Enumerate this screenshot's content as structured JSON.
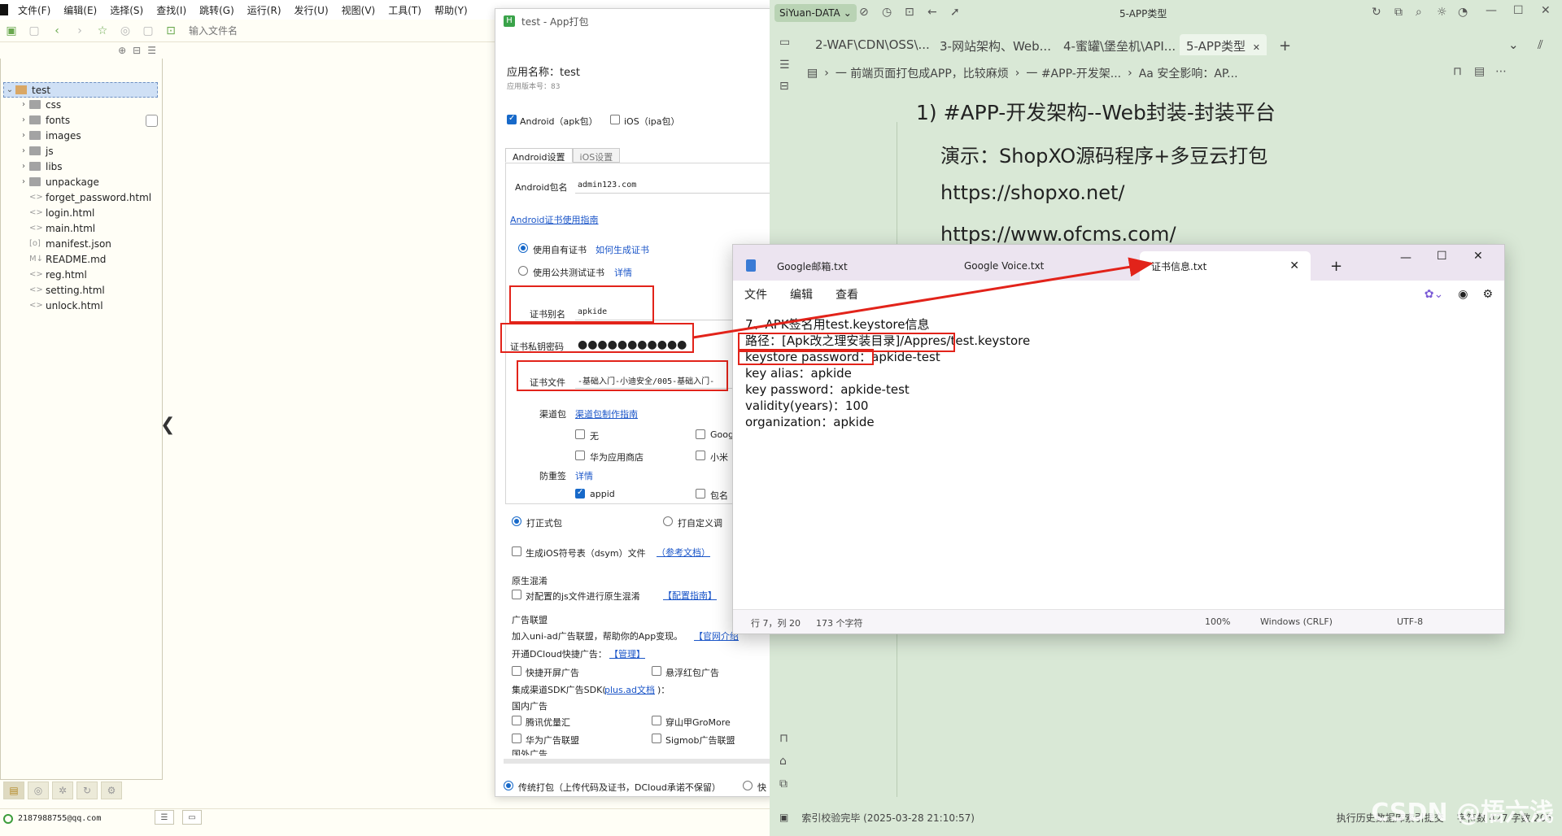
{
  "ide": {
    "menu": [
      "文件(F)",
      "编辑(E)",
      "选择(S)",
      "查找(I)",
      "跳转(G)",
      "运行(R)",
      "发行(U)",
      "视图(V)",
      "工具(T)",
      "帮助(Y)"
    ],
    "file_input_placeholder": "输入文件名",
    "tree": {
      "root": "test",
      "folders": [
        "css",
        "fonts",
        "images",
        "js",
        "libs",
        "unpackage"
      ],
      "files": [
        {
          "name": "forget_password.html",
          "icon": "<>"
        },
        {
          "name": "login.html",
          "icon": "<>"
        },
        {
          "name": "main.html",
          "icon": "<>"
        },
        {
          "name": "manifest.json",
          "icon": "[o]"
        },
        {
          "name": "README.md",
          "icon": "M↓"
        },
        {
          "name": "reg.html",
          "icon": "<>"
        },
        {
          "name": "setting.html",
          "icon": "<>"
        },
        {
          "name": "unlock.html",
          "icon": "<>"
        }
      ]
    },
    "status_user": "2187988755@qq.com"
  },
  "pkg": {
    "title": "test - App打包",
    "app_name": "应用名称：test",
    "app_version": "应用版本号：83",
    "platform_android": "Android（apk包）",
    "platform_ios": "iOS（ipa包）",
    "tab_android": "Android设置",
    "tab_ios": "iOS设置",
    "package_label": "Android包名",
    "package_value": "admin123.com",
    "cert_guide": "Android证书使用指南",
    "own_cert": "使用自有证书",
    "how_cert": "如何生成证书",
    "public_cert": "使用公共测试证书",
    "detail": "详情",
    "alias_label": "证书别名",
    "alias_value": "apkide",
    "password_label": "证书私钥密码",
    "password_value": "●●●●●●●●●●●",
    "file_label": "证书文件",
    "file_value": "-基础入门-小迪安全/005-基础入门-",
    "channel_label": "渠道包",
    "channel_guide": "渠道包制作指南",
    "ch_none": "无",
    "ch_google": "Goog",
    "ch_huawei": "华为应用商店",
    "ch_xiaomi": "小米",
    "anti_sign": "防重签",
    "anti_detail": "详情",
    "appid": "appid",
    "pkgname": "包名",
    "formal_pkg": "打正式包",
    "custom_pkg": "打自定义调",
    "dsym": "生成iOS符号表（dsym）文件",
    "dsym_doc": "（参考文档）",
    "native_mix": "原生混淆",
    "native_mix_cb": "对配置的js文件进行原生混淆",
    "native_mix_link": "【配置指南】",
    "ad_title": "广告联盟",
    "ad_join": "加入uni-ad广告联盟，帮助你的App变现。",
    "ad_join_link": "【官网介绍",
    "ad_quick": "开通DCloud快捷广告：",
    "ad_manage": "【管理】",
    "ad_splash": "快捷开屏广告",
    "ad_redpack": "悬浮红包广告",
    "ad_sdk": "集成渠道SDK广告SDK(",
    "ad_sdk_link": "plus.ad文档",
    "ad_sdk_end": ")：",
    "ad_domestic": "国内广告",
    "ad_tencent": "腾讯优量汇",
    "ad_gromore": "穿山甲GroMore",
    "ad_huawei": "华为广告联盟",
    "ad_sigmob": "Sigmob广告联盟",
    "ad_foreign": "国外广告",
    "traditional": "传统打包（上传代码及证书，DCloud承诺不保留）",
    "quick": "快"
  },
  "siyuan": {
    "workspace": "SiYuan-DATA",
    "window_title": "5-APP类型",
    "tabs": [
      "2-WAF\\CDN\\OSS\\...",
      "3-网站架构、Web...",
      "4-蜜罐\\堡垒机\\API...",
      "5-APP类型"
    ],
    "breadcrumb": [
      "一 前端页面打包成APP，比较麻烦",
      "一 #APP-开发架...",
      "Aa 安全影响：AP..."
    ],
    "heading": "1) #APP-开发架构--Web封装-封装平台",
    "lines": [
      "演示：ShopXO源码程序+多豆云打包",
      "https://shopxo.net/",
      "https://www.ofcms.com/"
    ],
    "status_left": "索引校验完毕 (2025-03-28 21:10:57)",
    "status_right": "执行历史数据库索引提交",
    "status_count": "字符数 427 字数 205"
  },
  "notepad": {
    "tabs": [
      "Google邮箱.txt",
      "Google Voice.txt",
      "证书信息.txt"
    ],
    "menu": [
      "文件",
      "编辑",
      "查看"
    ],
    "lines": [
      "7、APK签名用test.keystore信息",
      "路径：[Apk改之理安装目录]/Appres/test.keystore",
      "keystore password：apkide-test",
      "key alias：apkide",
      "key password：apkide-test",
      "validity(years)：100",
      "organization：apkide"
    ],
    "status_pos": "行 7，列 20",
    "status_chars": "173 个字符",
    "status_zoom": "100%",
    "status_eol": "Windows (CRLF)",
    "status_enc": "UTF-8"
  },
  "watermark": "CSDN @梧六浅",
  "colors": {
    "accent_red": "#e2231a",
    "siyuan_bg": "#d9e8d6",
    "link": "#1a55c8"
  }
}
